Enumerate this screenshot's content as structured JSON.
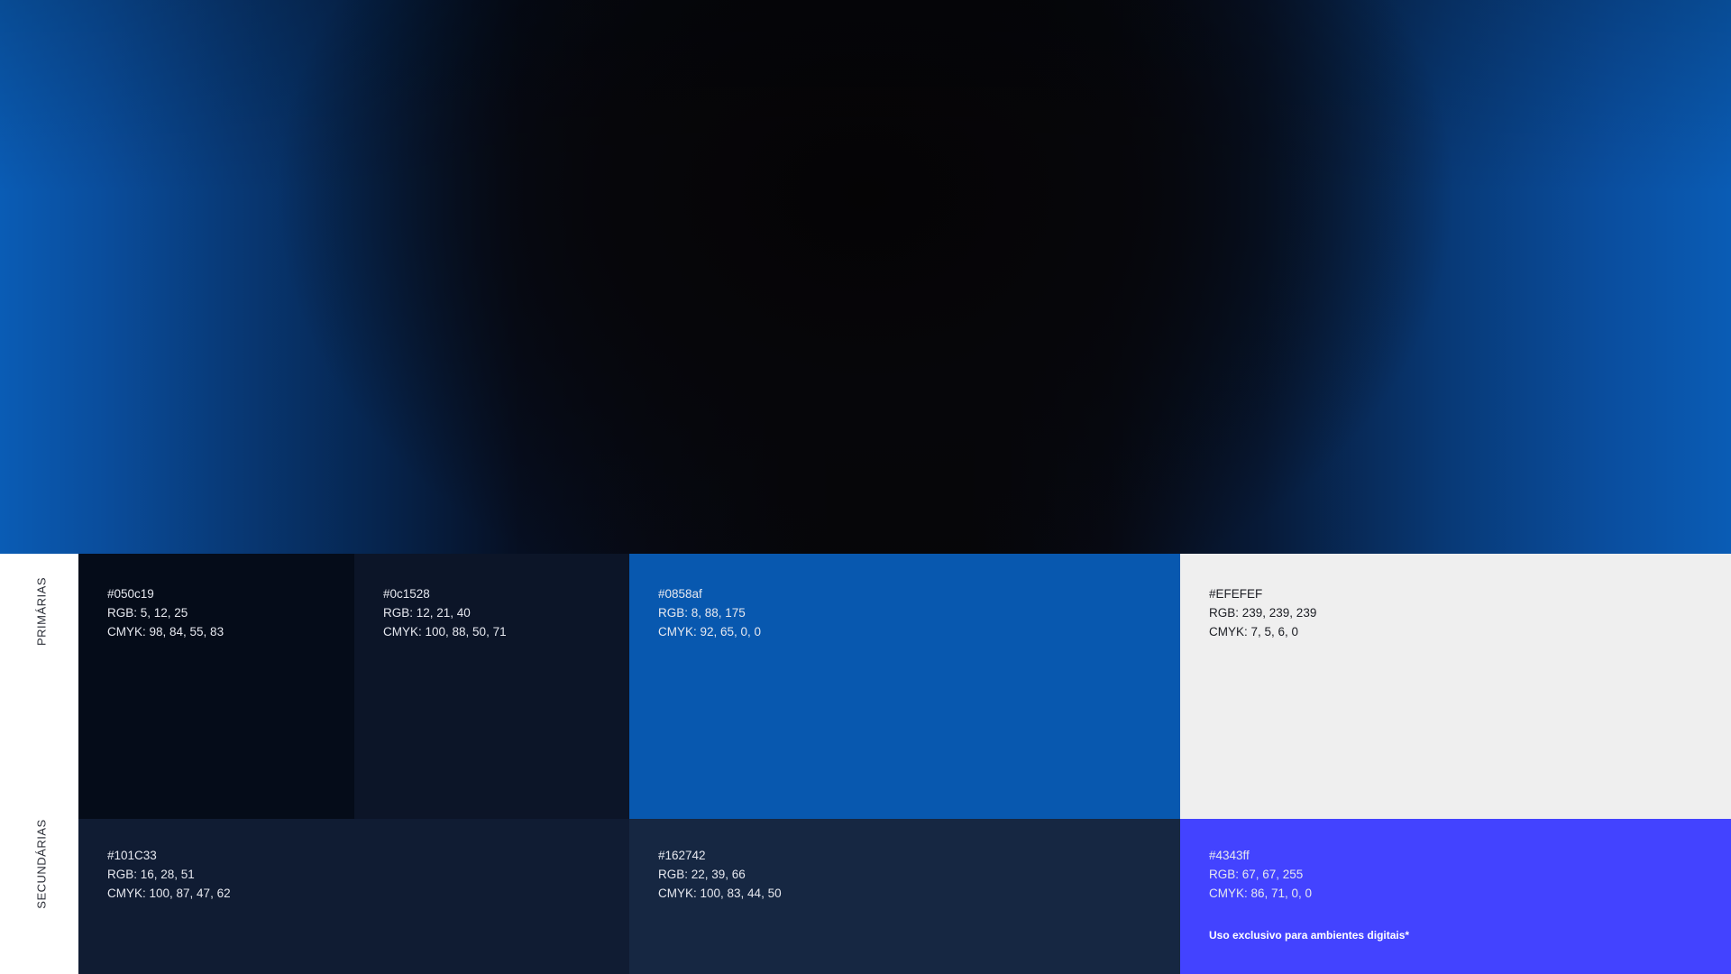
{
  "labels": {
    "primary": "PRIMÁRIAS",
    "secondary": "SECUNDÁRIAS"
  },
  "primary": [
    {
      "hex": "#050c19",
      "rgb": "RGB: 5, 12, 25",
      "cmyk": "CMYK: 98, 84, 55, 83",
      "color": "#050c19"
    },
    {
      "hex": "#0c1528",
      "rgb": "RGB: 12, 21, 40",
      "cmyk": "CMYK: 100, 88, 50, 71",
      "color": "#0c1528"
    },
    {
      "hex": "#0858af",
      "rgb": "RGB: 8, 88, 175",
      "cmyk": "CMYK: 92, 65, 0, 0",
      "color": "#0858af"
    },
    {
      "hex": "#EFEFEF",
      "rgb": "RGB: 239, 239, 239",
      "cmyk": "CMYK: 7, 5, 6, 0",
      "color": "#efefef"
    }
  ],
  "secondary": [
    {
      "hex": "#101C33",
      "rgb": "RGB: 16, 28, 51",
      "cmyk": "CMYK: 100, 87, 47, 62",
      "color": "#101c33"
    },
    {
      "hex": "#162742",
      "rgb": "RGB: 22, 39, 66",
      "cmyk": "CMYK: 100, 83, 44, 50",
      "color": "#162742"
    },
    {
      "hex": "#4343ff",
      "rgb": "RGB: 67, 67, 255",
      "cmyk": "CMYK: 86, 71, 0, 0",
      "color": "#4343ff",
      "note": "Uso exclusivo para ambientes digitais*"
    }
  ]
}
